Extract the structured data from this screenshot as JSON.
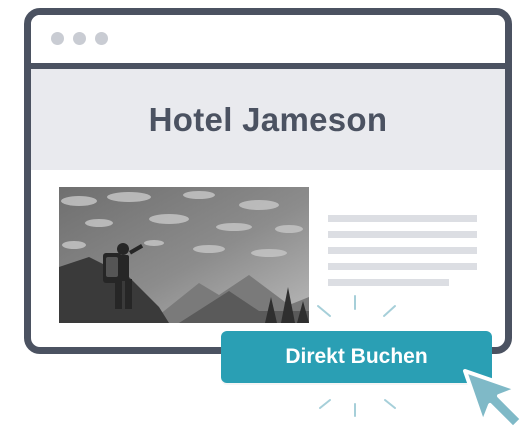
{
  "browser": {
    "window_controls": [
      "dot",
      "dot",
      "dot"
    ]
  },
  "hero": {
    "title": "Hotel Jameson"
  },
  "content": {
    "photo": "hiker-mountain-photo",
    "text_placeholder_lines": 5
  },
  "cta": {
    "label": "Direkt Buchen"
  },
  "colors": {
    "frame": "#4b5261",
    "hero_bg": "#e9eaee",
    "accent": "#2a9fb4",
    "cursor": "#7fb9c7"
  },
  "icons": {
    "cursor": "mouse-pointer-icon"
  }
}
